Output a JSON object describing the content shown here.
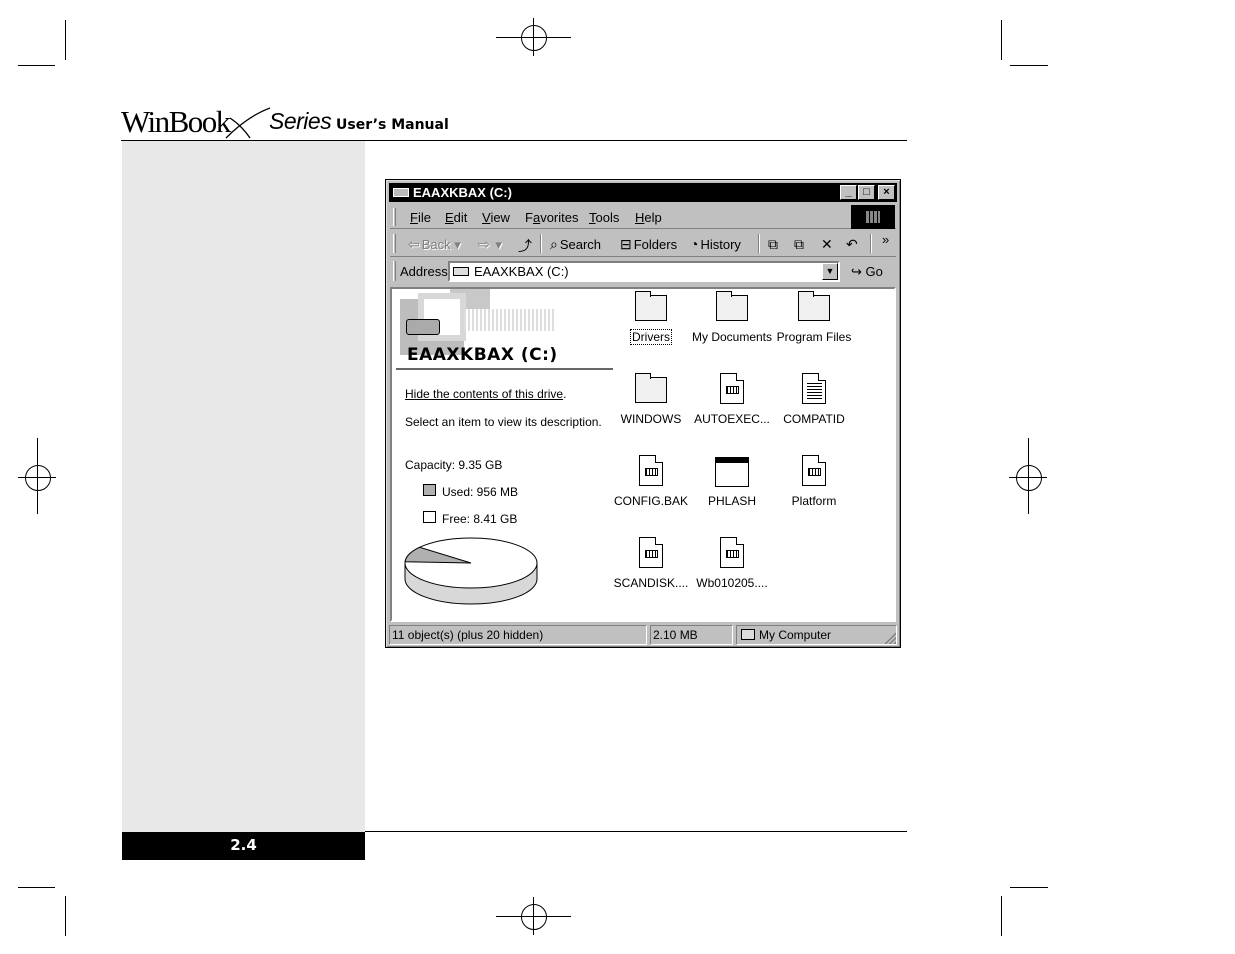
{
  "header": {
    "brand": "WinBook",
    "series": "Series",
    "manual": "User’s Manual"
  },
  "footer": {
    "page_number": "2.4"
  },
  "window": {
    "title": "EAAXKBAX (C:)",
    "controls": {
      "minimize": "_",
      "maximize": "□",
      "close": "×"
    },
    "menu": [
      {
        "key": "F",
        "rest": "ile"
      },
      {
        "key": "E",
        "rest": "dit"
      },
      {
        "key": "V",
        "rest": "iew"
      },
      {
        "pre": "F",
        "key": "a",
        "rest": "vorites"
      },
      {
        "key": "T",
        "rest": "ools"
      },
      {
        "key": "H",
        "rest": "elp"
      }
    ],
    "toolbar": {
      "back": "Back",
      "search": "Search",
      "folders": "Folders",
      "history": "History",
      "more": "»"
    },
    "address": {
      "label": "Address",
      "value": "EAAXKBAX (C:)",
      "go": "Go"
    },
    "sidebar": {
      "drive_title": "EAAXKBAX (C:)",
      "hide_link": "Hide the contents of this drive",
      "hide_suffix": ".",
      "select_hint": "Select an item to view its description.",
      "capacity": "Capacity: 9.35 GB",
      "used": "Used: 956 MB",
      "free": "Free: 8.41 GB",
      "used_fraction": 0.1,
      "colors": {
        "used": "#b0b0b0",
        "free": "#ffffff"
      }
    },
    "files": [
      {
        "name": "Drivers",
        "type": "folder",
        "selected": true
      },
      {
        "name": "My Documents",
        "type": "folder"
      },
      {
        "name": "Program Files",
        "type": "folder"
      },
      {
        "name": "WINDOWS",
        "type": "folder"
      },
      {
        "name": "AUTOEXEC...",
        "type": "config"
      },
      {
        "name": "COMPATID",
        "type": "text"
      },
      {
        "name": "CONFIG.BAK",
        "type": "config"
      },
      {
        "name": "PHLASH",
        "type": "app"
      },
      {
        "name": "Platform",
        "type": "config"
      },
      {
        "name": "SCANDISK....",
        "type": "config"
      },
      {
        "name": "Wb010205....",
        "type": "config"
      }
    ],
    "status": {
      "objects": "11 object(s) (plus 20 hidden)",
      "size": "2.10 MB",
      "zone": "My Computer"
    }
  }
}
